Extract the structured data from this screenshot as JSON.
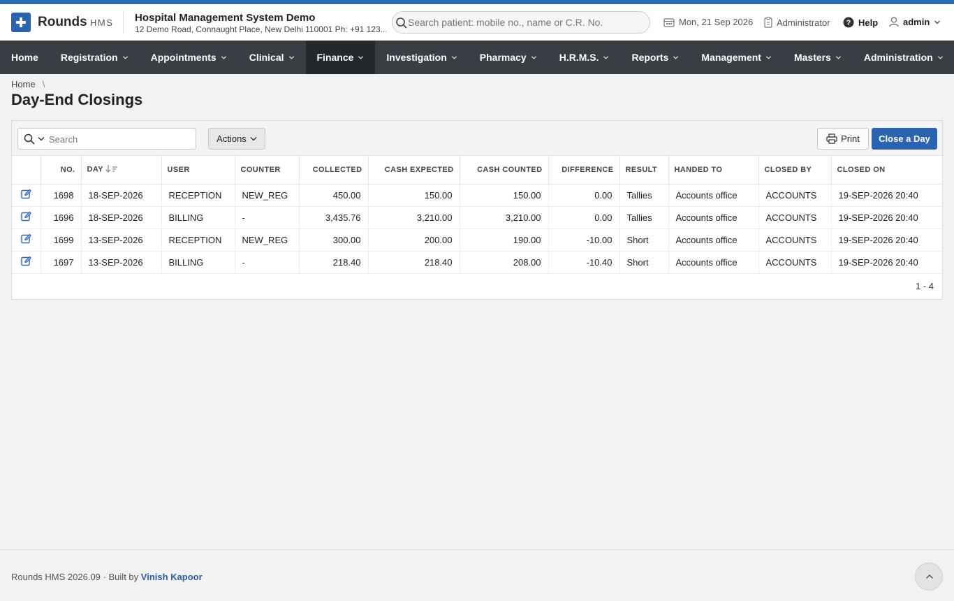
{
  "header": {
    "brand": "Rounds",
    "brand_sub": "HMS",
    "org_name": "Hospital Management System Demo",
    "org_address": "12 Demo Road, Connaught Place, New Delhi 110001 Ph: +91 123...",
    "search_placeholder": "Search patient: mobile no., name or C.R. No.",
    "date": "Mon, 21 Sep 2026",
    "role": "Administrator",
    "help": "Help",
    "user": "admin"
  },
  "nav": {
    "items": [
      "Home",
      "Registration",
      "Appointments",
      "Clinical",
      "Finance",
      "Investigation",
      "Pharmacy",
      "H.R.M.S.",
      "Reports",
      "Management",
      "Masters",
      "Administration"
    ],
    "active": "Finance"
  },
  "breadcrumb": {
    "home": "Home",
    "separator": "\\"
  },
  "page": {
    "title": "Day-End Closings"
  },
  "toolbar": {
    "search_placeholder": "Search",
    "actions_label": "Actions",
    "print_label": "Print",
    "close_day_label": "Close a Day"
  },
  "table": {
    "columns": [
      "NO.",
      "DAY",
      "USER",
      "COUNTER",
      "COLLECTED",
      "CASH EXPECTED",
      "CASH COUNTED",
      "DIFFERENCE",
      "RESULT",
      "HANDED TO",
      "CLOSED BY",
      "CLOSED ON"
    ],
    "rows": [
      [
        "1698",
        "18-SEP-2026",
        "RECEPTION",
        "NEW_REG",
        "450.00",
        "150.00",
        "150.00",
        "0.00",
        "Tallies",
        "Accounts office",
        "ACCOUNTS",
        "19-SEP-2026 20:40"
      ],
      [
        "1696",
        "18-SEP-2026",
        "BILLING",
        "-",
        "3,435.76",
        "3,210.00",
        "3,210.00",
        "0.00",
        "Tallies",
        "Accounts office",
        "ACCOUNTS",
        "19-SEP-2026 20:40"
      ],
      [
        "1699",
        "13-SEP-2026",
        "RECEPTION",
        "NEW_REG",
        "300.00",
        "200.00",
        "190.00",
        "-10.00",
        "Short",
        "Accounts office",
        "ACCOUNTS",
        "19-SEP-2026 20:40"
      ],
      [
        "1697",
        "13-SEP-2026",
        "BILLING",
        "-",
        "218.40",
        "218.40",
        "208.00",
        "-10.40",
        "Short",
        "Accounts office",
        "ACCOUNTS",
        "19-SEP-2026 20:40"
      ]
    ],
    "pagination": "1 - 4"
  },
  "footer": {
    "version": "Rounds HMS 2026.09",
    "dot": "·",
    "built_by": "Built by",
    "author": "Vinish Kapoor"
  },
  "colors": {
    "accent": "#2a63b0",
    "nav_bg": "#383e44",
    "nav_active": "#23282d"
  }
}
